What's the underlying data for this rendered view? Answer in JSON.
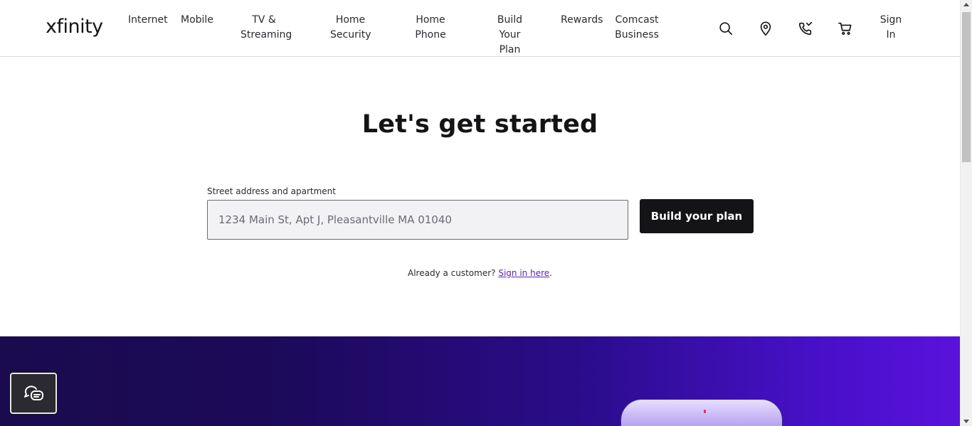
{
  "header": {
    "logo": "xfinity",
    "nav": [
      {
        "line1": "Internet",
        "line2": ""
      },
      {
        "line1": "Mobile",
        "line2": ""
      },
      {
        "line1": "TV &",
        "line2": "Streaming"
      },
      {
        "line1": "Home",
        "line2": "Security"
      },
      {
        "line1": "Home",
        "line2": "Phone"
      },
      {
        "line1": "Build Your",
        "line2": "Plan"
      },
      {
        "line1": "Rewards",
        "line2": ""
      },
      {
        "line1": "Comcast",
        "line2": "Business"
      }
    ],
    "icons": [
      "search-icon",
      "location-pin-icon",
      "phone-icon",
      "cart-icon"
    ],
    "sign_in": {
      "line1": "Sign",
      "line2": "In"
    }
  },
  "main": {
    "title": "Let's get started",
    "address_label": "Street address and apartment",
    "address_placeholder": "1234 Main St, Apt J, Pleasantville MA 01040",
    "address_value": "",
    "build_button": "Build your plan",
    "customer_prefix": "Already a customer?",
    "customer_link": "Sign in here",
    "customer_suffix": "."
  },
  "chat": {
    "icon": "chat-bubbles-icon"
  },
  "colors": {
    "accent_link": "#5a23b9",
    "button_dark": "#141417",
    "promo_start": "#1a0b4e",
    "promo_end": "#5a12dc"
  }
}
